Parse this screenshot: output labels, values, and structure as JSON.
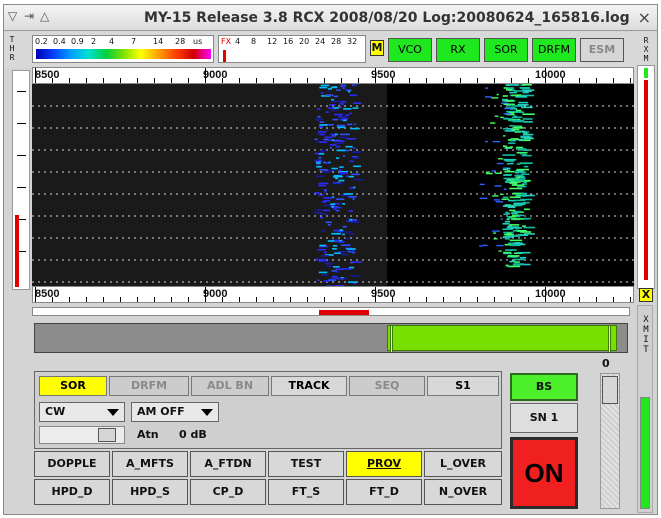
{
  "window": {
    "title": "MY-15 Release 3.8 RCX 2008/08/20 Log:20080624_165816.log",
    "titlebar_icons": [
      "menu-down-icon",
      "pin-icon",
      "shade-icon"
    ],
    "close_glyph": "×"
  },
  "indicators": {
    "thr_label": "THR",
    "scale_labels": [
      "0.2",
      "0.4",
      "0.9",
      "2",
      "4",
      "7",
      "14",
      "28",
      "us"
    ],
    "fx_labels": [
      "FX",
      "4",
      "8",
      "12",
      "16",
      "20",
      "24",
      "28",
      "32"
    ],
    "m_label": "M",
    "buttons": [
      {
        "label": "VCO",
        "state": "on"
      },
      {
        "label": "RX",
        "state": "on"
      },
      {
        "label": "SOR",
        "state": "on"
      },
      {
        "label": "DRFM",
        "state": "on"
      },
      {
        "label": "ESM",
        "state": "off"
      }
    ],
    "rxm_label": "RXM"
  },
  "spectrum": {
    "ruler_labels": [
      "8500",
      "9000",
      "9500",
      "10000"
    ],
    "x_marker": "X"
  },
  "xmit_label": "XMIT",
  "controls": {
    "tabs": [
      {
        "label": "SOR",
        "state": "active"
      },
      {
        "label": "DRFM",
        "state": "disabled"
      },
      {
        "label": "ADL  BN",
        "state": "disabled"
      },
      {
        "label": "TRACK",
        "state": "normal"
      },
      {
        "label": "SEQ",
        "state": "disabled"
      },
      {
        "label": "S1",
        "state": "normal"
      }
    ],
    "mode_select": "CW",
    "am_select": "AM OFF",
    "atn_label": "Atn",
    "atn_value": "0  dB",
    "function_buttons": [
      {
        "label": "DOPPLE",
        "active": false
      },
      {
        "label": "A_MFTS",
        "active": false
      },
      {
        "label": "A_FTDN",
        "active": false
      },
      {
        "label": "TEST",
        "active": false
      },
      {
        "label": "PROV",
        "active": true
      },
      {
        "label": "L_OVER",
        "active": false
      },
      {
        "label": "HPD_D",
        "active": false
      },
      {
        "label": "HPD_S",
        "active": false
      },
      {
        "label": "CP_D",
        "active": false
      },
      {
        "label": "FT_S",
        "active": false
      },
      {
        "label": "FT_D",
        "active": false
      },
      {
        "label": "N_OVER",
        "active": false
      }
    ],
    "bs_label": "BS",
    "sn_label": "SN 1",
    "on_label": "ON",
    "level_value": "0"
  },
  "colors": {
    "green": "#1fe81f",
    "yellow": "#ffff00",
    "red": "#f02020"
  }
}
